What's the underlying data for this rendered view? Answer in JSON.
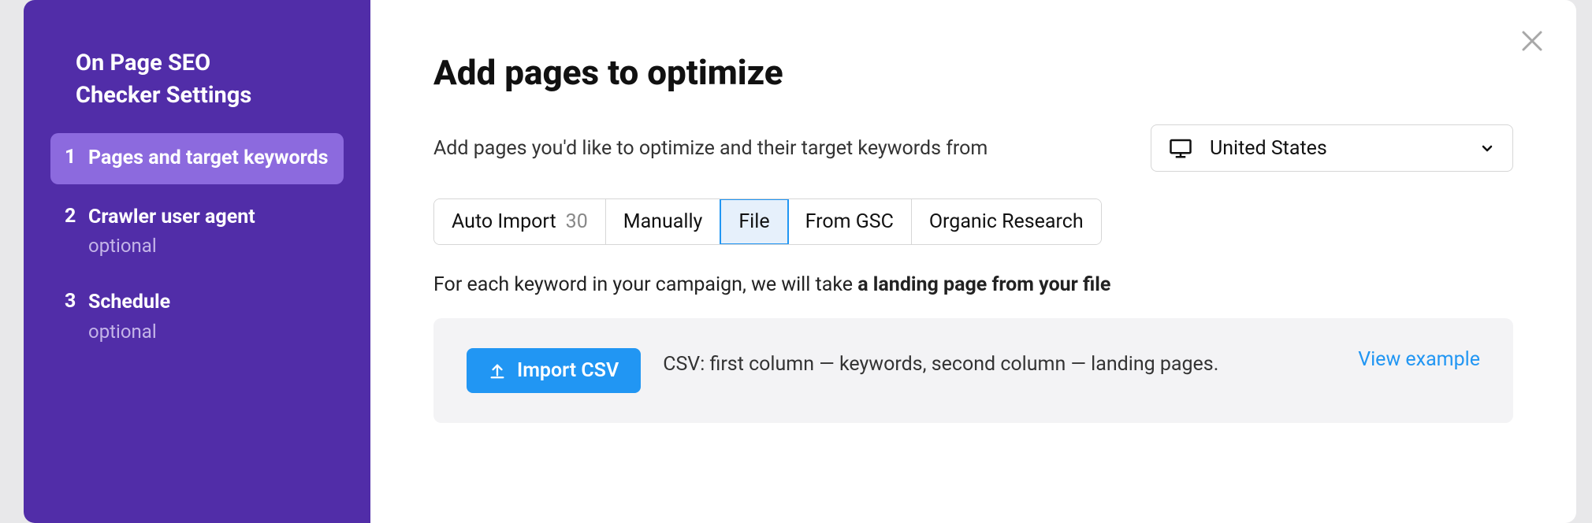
{
  "sidebar": {
    "title_line1": "On Page SEO",
    "title_line2": "Checker Settings",
    "steps": [
      {
        "number": "1",
        "label": "Pages and target keywords",
        "optional": "",
        "active": true
      },
      {
        "number": "2",
        "label": "Crawler user agent",
        "optional": "optional",
        "active": false
      },
      {
        "number": "3",
        "label": "Schedule",
        "optional": "optional",
        "active": false
      }
    ]
  },
  "main": {
    "title": "Add pages to optimize",
    "description": "Add pages you'd like to optimize and their target keywords from",
    "country": "United States",
    "tabs": [
      {
        "label": "Auto Import",
        "count": "30",
        "active": false
      },
      {
        "label": "Manually",
        "count": "",
        "active": false
      },
      {
        "label": "File",
        "count": "",
        "active": true
      },
      {
        "label": "From GSC",
        "count": "",
        "active": false
      },
      {
        "label": "Organic Research",
        "count": "",
        "active": false
      }
    ],
    "keyword_desc_prefix": "For each keyword in your campaign, we will take ",
    "keyword_desc_bold": "a landing page from your file",
    "import_button": "Import CSV",
    "import_desc": "CSV: first column — keywords, second column — landing pages.",
    "view_example": "View example"
  }
}
